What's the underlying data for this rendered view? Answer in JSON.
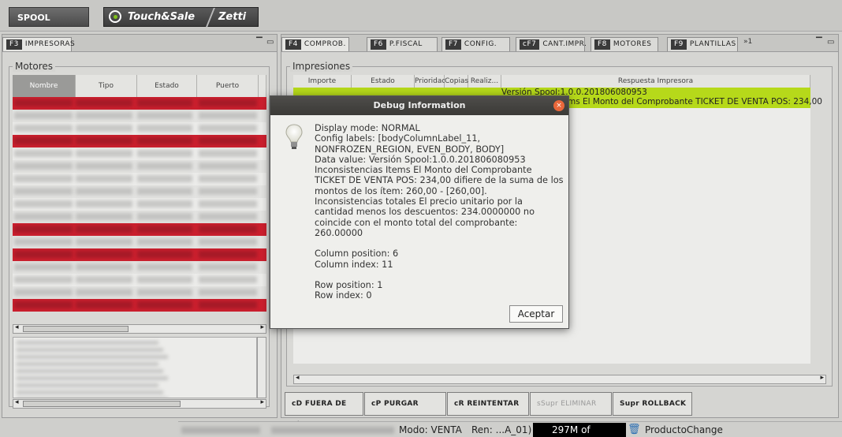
{
  "topbar": {
    "spool_label": "SPOOL",
    "brand_primary": "Touch&Sale",
    "brand_secondary": "Zetti"
  },
  "left_pane": {
    "tab": {
      "key": "F3",
      "label": "IMPRESORAS"
    },
    "group_title": "Motores",
    "columns": [
      "Nombre",
      "Tipo",
      "Estado",
      "Puerto"
    ]
  },
  "right_pane": {
    "tabs": [
      {
        "key": "F4",
        "label": "COMPROB."
      },
      {
        "key": "F6",
        "label": "P.FISCAL"
      },
      {
        "key": "F7",
        "label": "CONFIG."
      },
      {
        "key": "cF7",
        "label": "CANT.IMPR."
      },
      {
        "key": "F8",
        "label": "MOTORES"
      },
      {
        "key": "F9",
        "label": "PLANTILLAS"
      }
    ],
    "overflow_label": "»1",
    "group_title": "Impresiones",
    "columns": [
      "Importe",
      "Estado",
      "Prioridad",
      "Copias",
      "Realiz...",
      "Respuesta Impresora"
    ],
    "row": {
      "line1": "Versión Spool:1.0.0.201806080953",
      "line2": "ms El Monto del Comprobante TICKET DE VENTA POS: 234,00"
    }
  },
  "buttons": [
    {
      "key": "cD",
      "label": "FUERA DE LÍNEA"
    },
    {
      "key": "cP",
      "label": "PURGAR"
    },
    {
      "key": "cR",
      "label": "REINTENTAR"
    },
    {
      "key": "sSupr",
      "label": "ELIMINAR"
    },
    {
      "key": "Supr",
      "label": "ROLLBACK"
    }
  ],
  "statusbar": {
    "mode": "Modo: VENTA",
    "ren": "Ren: ...A_01)",
    "memory": "297M of",
    "event": "ProductoChange"
  },
  "dialog": {
    "title": "Debug Information",
    "close_label": "×",
    "lines": [
      "Display mode: NORMAL",
      "Config labels: [bodyColumnLabel_11, NONFROZEN_REGION, EVEN_BODY, BODY]",
      "Data value: Versión Spool:1.0.0.201806080953",
      "Inconsistencias Items El Monto del Comprobante TICKET DE VENTA POS: 234,00 difiere de la suma de los montos de los ítem: 260,00 - [260,00].",
      "Inconsistencias totales El precio unitario por la cantidad menos los descuentos: 234.0000000 no coincide con el monto total del comprobante: 260.00000",
      "",
      "Column position: 6",
      "Column index: 11",
      "",
      "Row position: 1",
      "Row index: 0"
    ],
    "ok_label": "Aceptar"
  },
  "colors": {
    "error_row": "#cc1f2e",
    "ok_row": "#b6d91a",
    "dialog_title": "#444340",
    "close_button": "#e9673a"
  }
}
